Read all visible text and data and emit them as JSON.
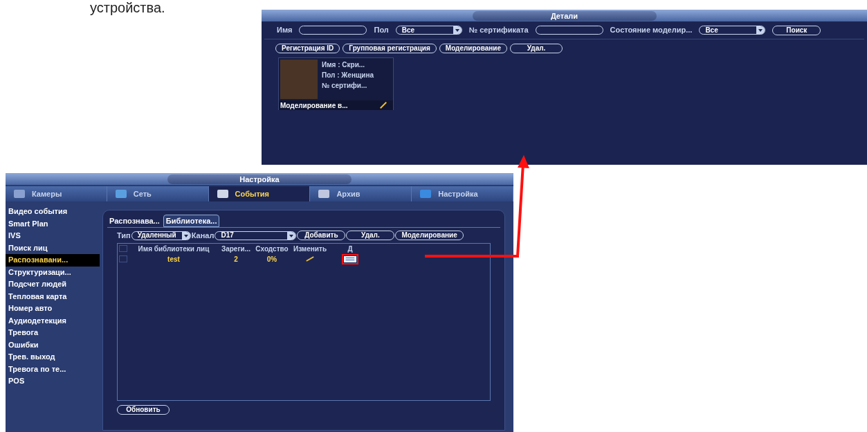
{
  "doc_text": "устройства.",
  "details": {
    "title": "Детали",
    "filters": [
      {
        "kind": "field",
        "label": "Имя"
      },
      {
        "kind": "select",
        "label": "Пол",
        "value": "Все"
      },
      {
        "kind": "field",
        "label": "№ сертификата"
      },
      {
        "kind": "select",
        "label": "Состояние моделир...",
        "value": "Все"
      }
    ],
    "search_button": "Поиск",
    "buttons": [
      "Регистрация ID",
      "Групповая регистрация",
      "Моделирование",
      "Удал."
    ],
    "cards": [
      {
        "lines": [
          "Имя : Скри...",
          "Пол : Женщина",
          "№ сертифи..."
        ],
        "status": "Моделирование в..."
      }
    ]
  },
  "settings": {
    "title": "Настройка",
    "tabs": [
      {
        "label": "Камеры",
        "selected": false
      },
      {
        "label": "Сеть",
        "selected": false
      },
      {
        "label": "События",
        "selected": true
      },
      {
        "label": "Архив",
        "selected": false
      },
      {
        "label": "Настройка",
        "selected": false
      }
    ],
    "sidebar": {
      "items": [
        {
          "label": "Видео события",
          "selected": false
        },
        {
          "label": "Smart Plan",
          "selected": false
        },
        {
          "label": "IVS",
          "selected": false
        },
        {
          "label": "Поиск лиц",
          "selected": false
        },
        {
          "label": "Распознавани...",
          "selected": true
        },
        {
          "label": "Структуризаци...",
          "selected": false
        },
        {
          "label": "Подсчет людей",
          "selected": false
        },
        {
          "label": "Тепловая карта",
          "selected": false
        },
        {
          "label": "Номер авто",
          "selected": false
        },
        {
          "label": "Аудиодетекция",
          "selected": false
        },
        {
          "label": "Тревога",
          "selected": false
        },
        {
          "label": "Ошибки",
          "selected": false
        },
        {
          "label": "Трев. выход",
          "selected": false
        },
        {
          "label": "Тревога по те...",
          "selected": false
        },
        {
          "label": "POS",
          "selected": false
        }
      ]
    },
    "subtabs": [
      {
        "label": "Распознава...",
        "selected": false
      },
      {
        "label": "Библиотека...",
        "selected": true
      }
    ],
    "type_label": "Тип",
    "type_value": "Удаленный",
    "channel_label": "Канал",
    "channel_value": "D17",
    "buttons": [
      "Добавить",
      "Удал.",
      "Моделирование"
    ],
    "table": {
      "columns": [
        "Имя библиотеки лиц",
        "Зареги...",
        "Сходство",
        "Изменить",
        "Д"
      ],
      "all_checked": false,
      "rows": [
        {
          "checked": false,
          "cells": [
            "test",
            "2",
            "0%"
          ]
        }
      ]
    },
    "refresh_button": "Обновить"
  }
}
